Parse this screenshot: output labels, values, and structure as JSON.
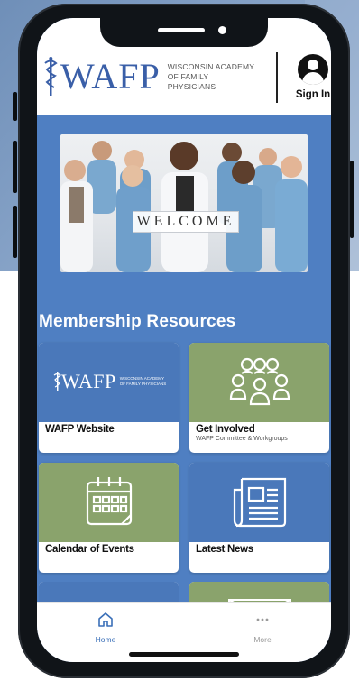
{
  "header": {
    "logo_text": "WAFP",
    "logo_subtitle_line1": "WISCONSIN ACADEMY",
    "logo_subtitle_line2": "OF FAMILY PHYSICIANS",
    "signin_label": "Sign In"
  },
  "hero": {
    "banner_text": "WELCOME"
  },
  "section": {
    "title": "Membership Resources"
  },
  "tiles": [
    {
      "label": "WAFP Website",
      "sub": "",
      "color": "#4a78ba",
      "icon": "wafp-logo"
    },
    {
      "label": "Get Involved",
      "sub": "WAFP Committee & Workgroups",
      "color": "#8aa36c",
      "icon": "group-icon"
    },
    {
      "label": "Calendar of Events",
      "sub": "",
      "color": "#8aa36c",
      "icon": "calendar-icon"
    },
    {
      "label": "Latest News",
      "sub": "",
      "color": "#4a78ba",
      "icon": "newspaper-icon"
    }
  ],
  "mini_logo": {
    "text": "WAFP",
    "sub": "WISCONSIN ACADEMY OF FAMILY PHYSICIANS"
  },
  "bottom_nav": {
    "items": [
      {
        "label": "Home",
        "icon": "home-icon",
        "active": true
      },
      {
        "label": "More",
        "icon": "more-icon",
        "active": false
      }
    ]
  },
  "colors": {
    "app_background": "#4f7fc2",
    "brand_blue": "#3a5fa8",
    "tile_blue": "#4a78ba",
    "tile_green": "#8aa36c",
    "nav_active": "#3a6fb8",
    "nav_inactive": "#9a9a9a"
  }
}
